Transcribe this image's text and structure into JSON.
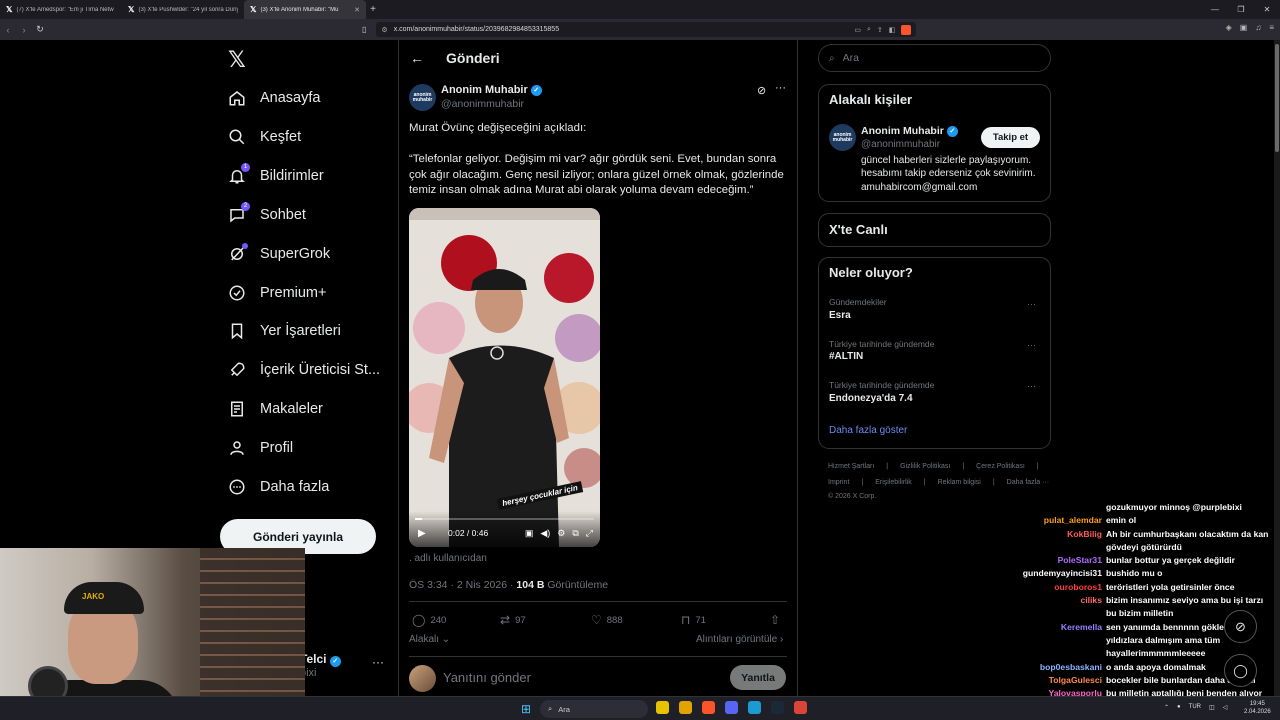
{
  "browser": {
    "tabs": [
      {
        "title": "(7) X'te Amedspor: \"Em ji Tîma Netw"
      },
      {
        "title": "(3) X'te Pushwlder: \"24 yıl sonra Düny"
      },
      {
        "title": "(3) X'te Anonim Muhabir: \"Mu"
      }
    ],
    "url": "x.com/anonimmuhabir/status/2039682984853315855"
  },
  "nav": {
    "items": [
      {
        "label": "Anasayfa",
        "icon": "home-icon"
      },
      {
        "label": "Keşfet",
        "icon": "search-icon"
      },
      {
        "label": "Bildirimler",
        "icon": "bell-icon",
        "badge": "1"
      },
      {
        "label": "Sohbet",
        "icon": "chat-icon",
        "badge": "2"
      },
      {
        "label": "SuperGrok",
        "icon": "grok-icon"
      },
      {
        "label": "Premium+",
        "icon": "premium-icon"
      },
      {
        "label": "Yer İşaretleri",
        "icon": "bookmark-icon"
      },
      {
        "label": "İçerik Üreticisi St...",
        "icon": "rocket-icon"
      },
      {
        "label": "Makaleler",
        "icon": "article-icon"
      },
      {
        "label": "Profil",
        "icon": "profile-icon"
      },
      {
        "label": "Daha fazla",
        "icon": "more-circle-icon"
      }
    ],
    "post_button": "Gönderi yayınla",
    "account_name": "Telci",
    "account_handle": "bixi"
  },
  "post": {
    "header_title": "Gönderi",
    "author": "Anonim Muhabir",
    "handle": "@anonimmuhabir",
    "avatar_text": "anonim muhabir",
    "text_line1": "Murat Övünç değişeceğini açıkladı:",
    "text_quote": "“Telefonlar geliyor. Değişim mi var? ağır gördük seni. Evet, bundan sonra çok ağır olacağım. Genç nesil izliyor; onlara güzel örnek olmak, gözlerinde temiz insan olmak adına Murat abi olarak yoluma devam edeceğim.”",
    "video": {
      "caption": "herşey çocuklar için",
      "time": "0:02 / 0:46",
      "progress": 0.04
    },
    "below_video": ". adlı kullanıcıdan",
    "time": "ÖS 3:34 · 2 Nis 2026 · ",
    "views_count": "104 B",
    "views_label": " Görüntüleme",
    "stats": {
      "replies": "240",
      "reposts": "97",
      "likes": "888",
      "bookmarks": "71"
    },
    "related_label": "Alakalı",
    "quotes_label": "Alıntıları görüntüle",
    "reply_placeholder": "Yanıtını gönder",
    "reply_button": "Yanıtla"
  },
  "sidebar": {
    "search_placeholder": "Ara",
    "related_title": "Alakalı kişiler",
    "related_person": {
      "name": "Anonim Muhabir",
      "handle": "@anonimmuhabir",
      "follow": "Takip et",
      "bio": "güncel haberleri sizlerle paylaşıyorum. hesabımı takip ederseniz çok sevinirim. amuhabircom@gmail.com"
    },
    "live_title": "X'te Canlı",
    "trends_title": "Neler oluyor?",
    "trends": [
      {
        "category": "Gündemdekiler",
        "name": "Esra"
      },
      {
        "category": "Türkiye tarihinde gündemde",
        "name": "#ALTIN"
      },
      {
        "category": "Türkiye tarihinde gündemde",
        "name": "Endonezya'da 7.4"
      }
    ],
    "show_more": "Daha fazla göster",
    "footer_row1": [
      "Hizmet Şartları",
      "|",
      "Gizlilik Politikası",
      "|",
      "Çerez Politikası",
      "|"
    ],
    "footer_row2": [
      "Imprint",
      "|",
      "Erişilebilirlik",
      "|",
      "Reklam bilgisi",
      "|",
      "Daha fazla ···"
    ],
    "copyright": "© 2026 X Corp."
  },
  "chat": [
    {
      "user": "",
      "msg": "gozukmuyor minnoş @purplebixi",
      "color": "#ffffff"
    },
    {
      "user": "pulat_alemdar",
      "msg": "emin ol",
      "color": "#ff9f1a"
    },
    {
      "user": "KokBilig",
      "msg": "Ah bir cumhurbaşkanı olacaktım da kan gövdeyi götürürdü",
      "color": "#ff5c5c"
    },
    {
      "user": "",
      "msg": "",
      "color": "#ffffff"
    },
    {
      "user": "PoleStar31",
      "msg": "bunlar bottur ya gerçek değildir",
      "color": "#b06cff"
    },
    {
      "user": "gundemyayincisi31",
      "msg": "bushido mu o",
      "color": "#ffffff"
    },
    {
      "user": "ouroboros1",
      "msg": "teröristleri yola getirsinler önce",
      "color": "#ff4040"
    },
    {
      "user": "ciliks",
      "msg": "bizim insanımız seviyo ama bu işi tarzı bu bizim milletin",
      "color": "#ff6b6b"
    },
    {
      "user": "",
      "msg": "",
      "color": "#ffffff"
    },
    {
      "user": "Keremella",
      "msg": "sen yanıımda bennnnn gökleeeeee yıldızlara dalmışım ama tüm hayallerimmmmmleeeee",
      "color": "#9a7dff"
    },
    {
      "user": "",
      "msg": "",
      "color": "#ffffff"
    },
    {
      "user": "bop0esbaskani",
      "msg": "o anda apoya domalmak",
      "color": "#8ab4ff"
    },
    {
      "user": "TolgaGulesci",
      "msg": "bocekler bile bunlardan daha degerli",
      "color": "#ff8a4c"
    },
    {
      "user": "Yalovasporlu",
      "msg": "bu milletin aptallığı beni benden alıyor",
      "color": "#ff66cc"
    }
  ],
  "taskbar": {
    "search": "Ara",
    "lang": "TUR",
    "time": "19:45",
    "date": "2.04.2026",
    "app_colors": [
      "#e8c100",
      "#e2a200",
      "#fb542b",
      "#5865f2",
      "#1b9bd1",
      "#1b2838",
      "#db4437"
    ]
  },
  "webcam": {
    "cap_text": "JAKO"
  }
}
